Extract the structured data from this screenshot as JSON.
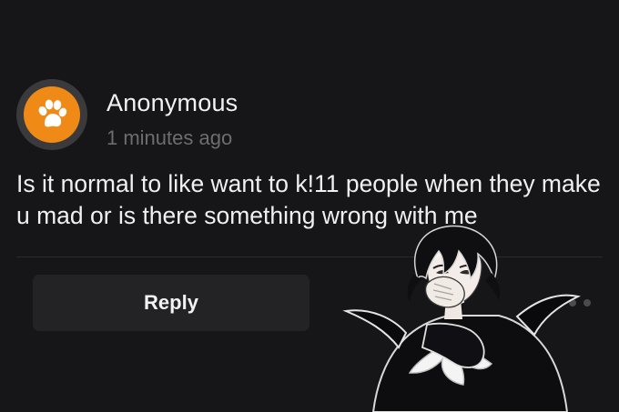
{
  "colors": {
    "background": "#161618",
    "avatar_accent": "#ef8a17",
    "reply_button": "#232326",
    "muted_text": "#6d6d70"
  },
  "post": {
    "avatar_icon": "paw-print-icon",
    "author": "Anonymous",
    "timestamp": "1 minutes ago",
    "body": "Is it normal to like want to k!11 people when they make u mad or is there something wrong with me"
  },
  "actions": {
    "reply_label": "Reply",
    "more_icon": "more-options-icon"
  },
  "overlay": {
    "sticker": "anime-character-sticker"
  }
}
